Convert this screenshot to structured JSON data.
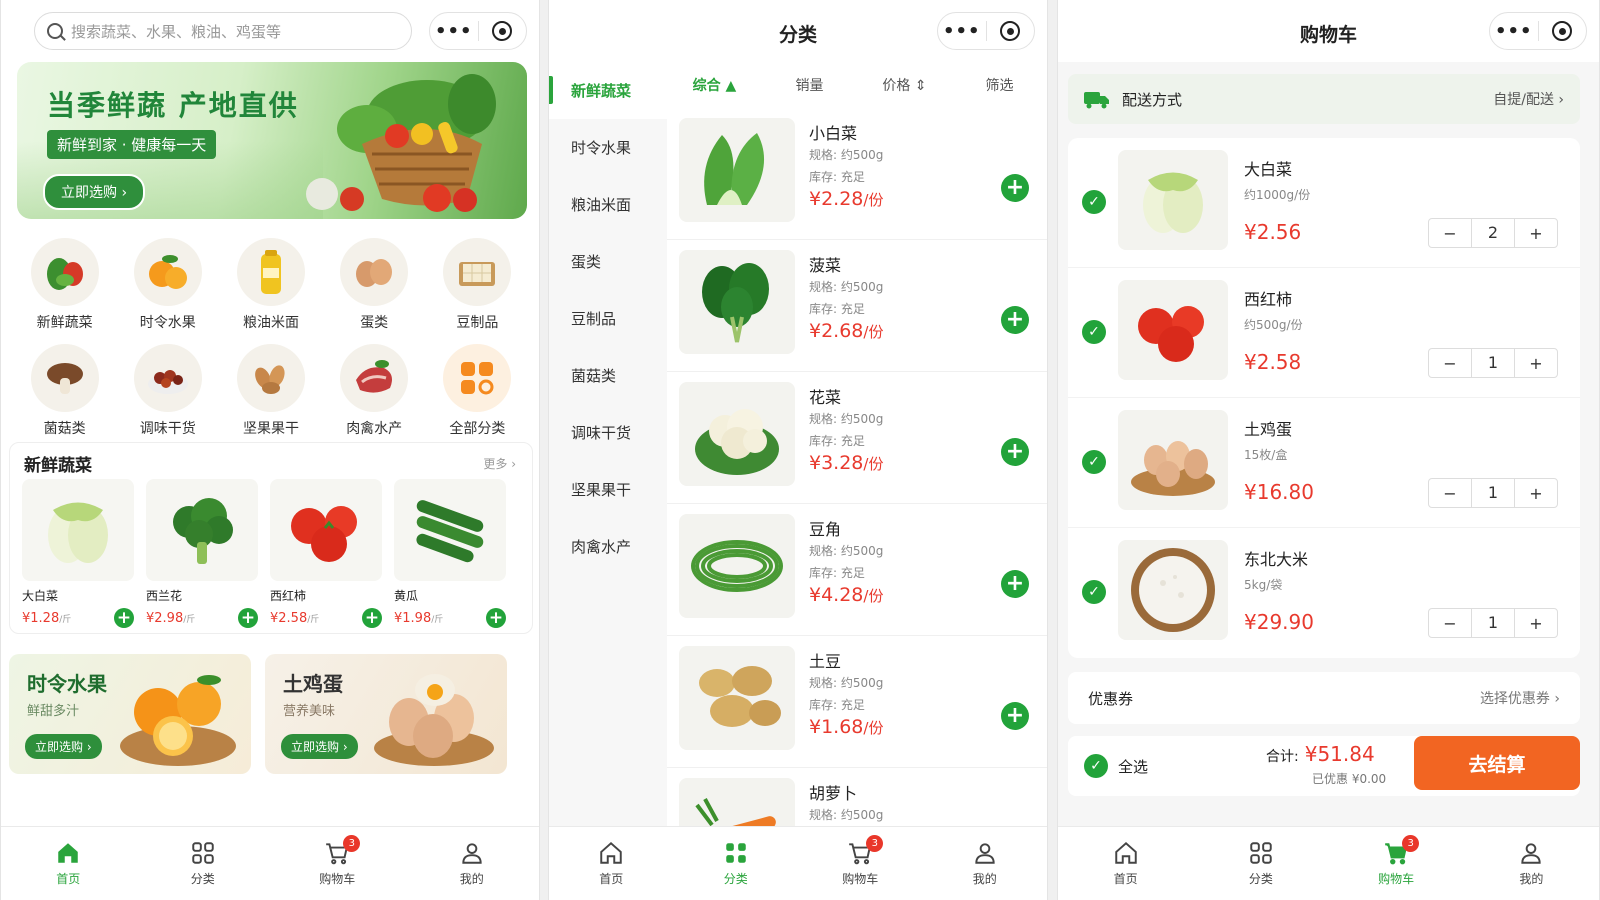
{
  "home": {
    "search_placeholder": "搜索蔬菜、水果、粮油、鸡蛋等",
    "banner": {
      "title": "当季鲜蔬 产地直供",
      "subtitle": "新鲜到家 · 健康每一天",
      "button": "立即选购 ›"
    },
    "categories": [
      {
        "label": "新鲜蔬菜",
        "icon": "vegetables-icon"
      },
      {
        "label": "时令水果",
        "icon": "oranges-icon"
      },
      {
        "label": "粮油米面",
        "icon": "oil-icon"
      },
      {
        "label": "蛋类",
        "icon": "eggs-icon"
      },
      {
        "label": "豆制品",
        "icon": "tofu-icon"
      },
      {
        "label": "菌菇类",
        "icon": "mushroom-icon"
      },
      {
        "label": "调味干货",
        "icon": "dried-goods-icon"
      },
      {
        "label": "坚果果干",
        "icon": "nuts-icon"
      },
      {
        "label": "肉禽水产",
        "icon": "meat-icon"
      },
      {
        "label": "全部分类",
        "icon": "grid-icon"
      }
    ],
    "section": {
      "title": "新鲜蔬菜",
      "more": "更多 ›",
      "products": [
        {
          "name": "大白菜",
          "price": "¥1.28",
          "unit": "/斤",
          "icon": "cabbage-icon"
        },
        {
          "name": "西兰花",
          "price": "¥2.98",
          "unit": "/斤",
          "icon": "broccoli-icon"
        },
        {
          "name": "西红柿",
          "price": "¥2.58",
          "unit": "/斤",
          "icon": "tomato-icon"
        },
        {
          "name": "黄瓜",
          "price": "¥1.98",
          "unit": "/斤",
          "icon": "cucumber-icon"
        }
      ]
    },
    "promos": [
      {
        "title": "时令水果",
        "subtitle": "鲜甜多汁",
        "button": "立即选购 ›"
      },
      {
        "title": "土鸡蛋",
        "subtitle": "营养美味",
        "button": "立即选购 ›"
      }
    ]
  },
  "category_page": {
    "title": "分类",
    "sidebar": [
      "新鲜蔬菜",
      "时令水果",
      "粮油米面",
      "蛋类",
      "豆制品",
      "菌菇类",
      "调味干货",
      "坚果果干",
      "肉禽水产"
    ],
    "filters": [
      "综合 ▲",
      "销量",
      "价格 ⇕",
      "筛选"
    ],
    "items": [
      {
        "name": "小白菜",
        "spec": "规格: 约500g",
        "stock": "库存: 充足",
        "price": "¥2.28",
        "unit": "/份"
      },
      {
        "name": "菠菜",
        "spec": "规格: 约500g",
        "stock": "库存: 充足",
        "price": "¥2.68",
        "unit": "/份"
      },
      {
        "name": "花菜",
        "spec": "规格: 约500g",
        "stock": "库存: 充足",
        "price": "¥3.28",
        "unit": "/份"
      },
      {
        "name": "豆角",
        "spec": "规格: 约500g",
        "stock": "库存: 充足",
        "price": "¥4.28",
        "unit": "/份"
      },
      {
        "name": "土豆",
        "spec": "规格: 约500g",
        "stock": "库存: 充足",
        "price": "¥1.68",
        "unit": "/份"
      },
      {
        "name": "胡萝卜",
        "spec": "规格: 约500g"
      }
    ]
  },
  "cart_page": {
    "title": "购物车",
    "delivery_label": "配送方式",
    "delivery_value": "自提/配送 ›",
    "items": [
      {
        "name": "大白菜",
        "spec": "约1000g/份",
        "price": "¥2.56",
        "qty": "2"
      },
      {
        "name": "西红柿",
        "spec": "约500g/份",
        "price": "¥2.58",
        "qty": "1"
      },
      {
        "name": "土鸡蛋",
        "spec": "15枚/盒",
        "price": "¥16.80",
        "qty": "1"
      },
      {
        "name": "东北大米",
        "spec": "5kg/袋",
        "price": "¥29.90",
        "qty": "1"
      }
    ],
    "coupon_label": "优惠券",
    "coupon_value": "选择优惠券 ›",
    "select_all": "全选",
    "total_label": "合计:",
    "total_value": "¥51.84",
    "discount": "已优惠 ¥0.00",
    "checkout": "去结算"
  },
  "tabbar": {
    "home": "首页",
    "category": "分类",
    "cart": "购物车",
    "mine": "我的",
    "cart_badge": "3"
  },
  "colors": {
    "brand_green": "#22a33a",
    "price_red": "#e83a2e",
    "checkout_orange": "#f26522"
  }
}
